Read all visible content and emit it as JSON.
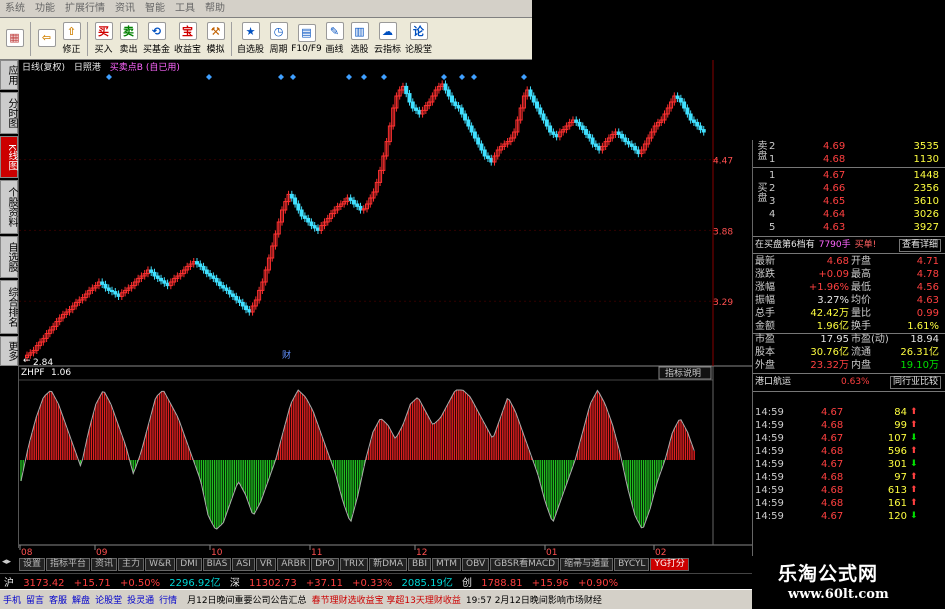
{
  "menubar": [
    "系统",
    "功能",
    "扩展行情",
    "资讯",
    "智能",
    "工具",
    "帮助"
  ],
  "toolbar": [
    {
      "label": "",
      "icon": "grid-icon"
    },
    {
      "label": "",
      "icon": "back-arrow-icon"
    },
    {
      "label": "修正",
      "icon": "up-arrow-icon"
    },
    {
      "label": "买入",
      "icon": "buy-icon"
    },
    {
      "label": "卖出",
      "icon": "sell-icon"
    },
    {
      "label": "买基金",
      "icon": "fund-icon"
    },
    {
      "label": "收益宝",
      "icon": "treasure-icon"
    },
    {
      "label": "模拟",
      "icon": "simulate-icon"
    },
    {
      "label": "自选股",
      "icon": "star-icon"
    },
    {
      "label": "周期",
      "icon": "clock-icon"
    },
    {
      "label": "F10/F9",
      "icon": "f10-icon"
    },
    {
      "label": "画线",
      "icon": "pen-icon"
    },
    {
      "label": "选股",
      "icon": "screen-icon"
    },
    {
      "label": "云指标",
      "icon": "cloud-icon"
    },
    {
      "label": "论股堂",
      "icon": "discuss-icon"
    }
  ],
  "left_tabs": [
    {
      "label": "应用",
      "active": false
    },
    {
      "label": "分时图",
      "active": false
    },
    {
      "label": "K线图",
      "active": true
    },
    {
      "label": "个股资料",
      "active": false
    },
    {
      "label": "自选股",
      "active": false
    },
    {
      "label": "综合排名",
      "active": false
    },
    {
      "label": "更多",
      "active": false
    }
  ],
  "chart_header": {
    "period": "日线(复权)",
    "stock": "日照港",
    "indicator": "买卖点B",
    "note": "(自已用)"
  },
  "chart_data": [
    {
      "type": "candlestick",
      "price_ticks": [
        "4.47",
        "3.88",
        "3.29"
      ],
      "low_label": "2.84",
      "finance_marker": "财",
      "x_ticks": [
        "08",
        "09",
        "10",
        "11",
        "12",
        "01",
        "02"
      ],
      "close": [
        2.84,
        2.86,
        2.88,
        2.92,
        2.95,
        2.98,
        3.02,
        3.05,
        3.08,
        3.12,
        3.15,
        3.18,
        3.2,
        3.22,
        3.25,
        3.28,
        3.3,
        3.32,
        3.35,
        3.38,
        3.4,
        3.42,
        3.45,
        3.43,
        3.4,
        3.38,
        3.37,
        3.35,
        3.33,
        3.36,
        3.38,
        3.4,
        3.42,
        3.45,
        3.48,
        3.5,
        3.52,
        3.55,
        3.53,
        3.5,
        3.48,
        3.46,
        3.44,
        3.42,
        3.45,
        3.48,
        3.5,
        3.52,
        3.55,
        3.58,
        3.6,
        3.62,
        3.6,
        3.58,
        3.55,
        3.52,
        3.5,
        3.48,
        3.45,
        3.42,
        3.4,
        3.38,
        3.35,
        3.33,
        3.3,
        3.28,
        3.25,
        3.22,
        3.2,
        3.25,
        3.3,
        3.38,
        3.45,
        3.55,
        3.65,
        3.75,
        3.85,
        3.95,
        4.05,
        4.12,
        4.18,
        4.15,
        4.1,
        4.05,
        4.0,
        3.98,
        3.95,
        3.92,
        3.9,
        3.88,
        3.92,
        3.95,
        3.98,
        4.02,
        4.05,
        4.08,
        4.1,
        4.12,
        4.15,
        4.13,
        4.1,
        4.08,
        4.05,
        4.06,
        4.1,
        4.15,
        4.2,
        4.28,
        4.38,
        4.5,
        4.62,
        4.75,
        4.9,
        5.0,
        5.05,
        5.08,
        5.02,
        4.95,
        4.9,
        4.88,
        4.85,
        4.88,
        4.92,
        4.95,
        5.0,
        5.05,
        5.08,
        5.1,
        5.05,
        5.0,
        4.95,
        4.92,
        4.9,
        4.85,
        4.8,
        4.75,
        4.7,
        4.65,
        4.6,
        4.55,
        4.5,
        4.48,
        4.45,
        4.5,
        4.55,
        4.58,
        4.6,
        4.62,
        4.65,
        4.7,
        4.8,
        4.9,
        5.0,
        5.05,
        5.0,
        4.95,
        4.9,
        4.85,
        4.8,
        4.75,
        4.7,
        4.68,
        4.66,
        4.7,
        4.72,
        4.75,
        4.78,
        4.8,
        4.78,
        4.75,
        4.72,
        4.68,
        4.65,
        4.6,
        4.58,
        4.55,
        4.58,
        4.62,
        4.65,
        4.68,
        4.7,
        4.68,
        4.65,
        4.62,
        4.6,
        4.58,
        4.55,
        4.52,
        4.55,
        4.6,
        4.65,
        4.7,
        4.75,
        4.78,
        4.8,
        4.85,
        4.9,
        4.95,
        5.0,
        4.98,
        4.95,
        4.9,
        4.85,
        4.8,
        4.78,
        4.75,
        4.72,
        4.7
      ]
    },
    {
      "type": "bar",
      "indicator": "ZHPF",
      "value": "1.06",
      "label": "指标说明",
      "profile": [
        -0.3,
        0.2,
        0.6,
        0.9,
        1.0,
        0.8,
        0.5,
        0.2,
        -0.1,
        0.4,
        0.8,
        1.0,
        0.8,
        0.5,
        0.2,
        -0.2,
        0.1,
        0.5,
        0.9,
        1.0,
        0.8,
        0.6,
        0.3,
        0.0,
        -0.3,
        -0.8,
        -1.0,
        -0.9,
        -0.6,
        -0.3,
        -0.5,
        -0.8,
        -0.6,
        -0.3,
        0.0,
        0.4,
        0.8,
        1.0,
        0.9,
        0.7,
        0.4,
        0.1,
        -0.2,
        -0.6,
        -0.9,
        -0.5,
        0.0,
        0.4,
        0.6,
        0.5,
        0.3,
        0.5,
        0.8,
        0.9,
        0.7,
        0.5,
        0.6,
        0.8,
        1.0,
        1.0,
        0.9,
        0.7,
        0.5,
        0.3,
        0.6,
        0.9,
        0.7,
        0.4,
        0.1,
        -0.2,
        -0.6,
        -0.9,
        -0.6,
        -0.3,
        0.0,
        0.4,
        0.8,
        1.0,
        0.8,
        0.5,
        0.1,
        -0.4,
        -0.8,
        -1.0,
        -0.7,
        -0.3,
        0.0,
        0.4,
        0.6,
        0.4,
        0.1
      ]
    }
  ],
  "tabbar": [
    "设置",
    "指标平台",
    "资讯",
    "主力",
    "W&R",
    "DMI",
    "BIAS",
    "ASI",
    "VR",
    "ARBR",
    "DPO",
    "TRIX",
    "新DMA",
    "BBI",
    "MTM",
    "OBV",
    "GBSR看MACD",
    "缩帚与通量",
    "BYCYL",
    "YG打分"
  ],
  "indexbar": {
    "sh_label": "沪",
    "sh_value": "3173.42",
    "sh_change": "+15.71",
    "sh_pct": "+0.50%",
    "sh_amount": "2296.92亿",
    "sz_label": "深",
    "sz_value": "11302.73",
    "sz_change": "+37.11",
    "sz_pct": "+0.33%",
    "sz_amount": "2085.19亿",
    "cy_label": "创",
    "cy_value": "1788.81",
    "cy_change": "+15.96",
    "cy_pct": "+0.90%"
  },
  "statusbar": {
    "items": [
      "手机",
      "留言",
      "客服",
      "解盘",
      "论股堂",
      "投灵通",
      "行情"
    ],
    "news1": "月12日晚间重要公司公告汇总",
    "news2": "春节理财选收益宝 享超13天理财收益",
    "time_news": "19:57 2月12日晚间影响市场财经"
  },
  "orderbook": {
    "ask_side": "卖盘",
    "bid_side": "买盘",
    "asks": [
      {
        "level": "2",
        "price": "4.69",
        "volume": "3535"
      },
      {
        "level": "1",
        "price": "4.68",
        "volume": "1130"
      }
    ],
    "bids": [
      {
        "level": "1",
        "price": "4.67",
        "volume": "1448"
      },
      {
        "level": "2",
        "price": "4.66",
        "volume": "2356"
      },
      {
        "level": "3",
        "price": "4.65",
        "volume": "3610"
      },
      {
        "level": "4",
        "price": "4.64",
        "volume": "3026"
      },
      {
        "level": "5",
        "price": "4.63",
        "volume": "3927"
      }
    ],
    "queue_label": "在买盘第6档有",
    "queue_volume": "7790手",
    "buy_label": "买单!",
    "detail_label": "查看详细"
  },
  "stats": [
    {
      "k1": "最新",
      "v1": "4.68",
      "c1": "r",
      "k2": "开盘",
      "v2": "4.71",
      "c2": "r"
    },
    {
      "k1": "涨跌",
      "v1": "+0.09",
      "c1": "r",
      "k2": "最高",
      "v2": "4.78",
      "c2": "r"
    },
    {
      "k1": "涨幅",
      "v1": "+1.96%",
      "c1": "r",
      "k2": "最低",
      "v2": "4.56",
      "c2": "r"
    },
    {
      "k1": "振幅",
      "v1": "3.27%",
      "c1": "w",
      "k2": "均价",
      "v2": "4.63",
      "c2": "r"
    },
    {
      "k1": "总手",
      "v1": "42.42万",
      "c1": "y",
      "k2": "量比",
      "v2": "0.99",
      "c2": "r"
    },
    {
      "k1": "金额",
      "v1": "1.96亿",
      "c1": "y",
      "k2": "换手",
      "v2": "1.61%",
      "c2": "y"
    },
    {
      "k1": "市盈",
      "v1": "17.95",
      "c1": "w",
      "k2": "市盈(动)",
      "v2": "18.94",
      "c2": "w"
    },
    {
      "k1": "股本",
      "v1": "30.76亿",
      "c1": "y",
      "k2": "流通",
      "v2": "26.31亿",
      "c2": "y"
    },
    {
      "k1": "外盘",
      "v1": "23.32万",
      "c1": "r",
      "k2": "内盘",
      "v2": "19.10万",
      "c2": "g"
    }
  ],
  "sector": {
    "name": "港口航运",
    "pct": "0.63%",
    "compare": "同行业比较"
  },
  "ticks": [
    {
      "time": "14:59",
      "price": "4.67",
      "volume": "84",
      "dir": "up"
    },
    {
      "time": "14:59",
      "price": "4.68",
      "volume": "99",
      "dir": "up"
    },
    {
      "time": "14:59",
      "price": "4.67",
      "volume": "107",
      "dir": "down"
    },
    {
      "time": "14:59",
      "price": "4.68",
      "volume": "596",
      "dir": "up"
    },
    {
      "time": "14:59",
      "price": "4.67",
      "volume": "301",
      "dir": "down"
    },
    {
      "time": "14:59",
      "price": "4.68",
      "volume": "97",
      "dir": "up"
    },
    {
      "time": "14:59",
      "price": "4.68",
      "volume": "613",
      "dir": "up"
    },
    {
      "time": "14:59",
      "price": "4.68",
      "volume": "161",
      "dir": "up"
    },
    {
      "time": "14:59",
      "price": "4.67",
      "volume": "120",
      "dir": "down"
    }
  ],
  "watermark": {
    "title": "乐淘公式网",
    "url": "www.60lt.com"
  },
  "colors": {
    "up": "#ff4040",
    "down": "#00e000",
    "candle_down": "#40e0ff",
    "yellow": "#ffff40",
    "active_tab": "#cc0000"
  }
}
